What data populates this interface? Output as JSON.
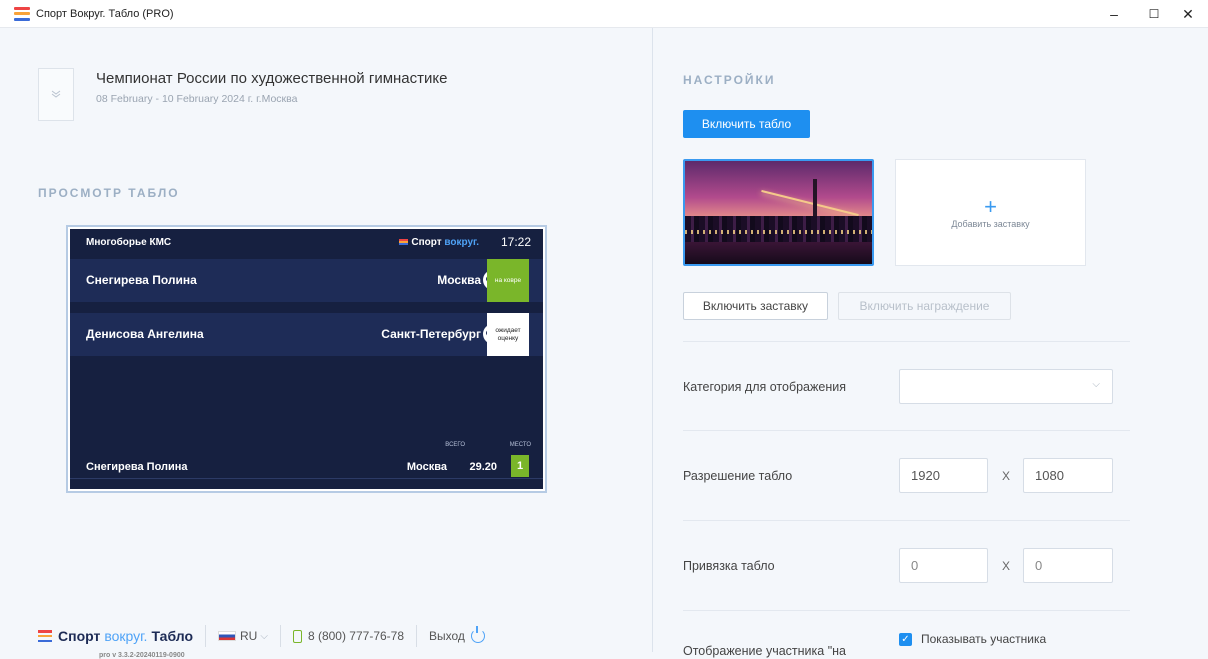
{
  "window": {
    "title": "Спорт Вокруг. Табло (PRO)",
    "minimize": "–",
    "maximize": "☐",
    "close": "✕"
  },
  "event": {
    "title": "Чемпионат России по художественной гимнастике",
    "dates": "08 February - 10 February 2024 г. г.Москва"
  },
  "preview": {
    "section_title": "ПРОСМОТР ТАБЛО",
    "board": {
      "category": "Многоборье КМС",
      "logo_a": "Спорт",
      "logo_b": "вокруг.",
      "time": "17:22",
      "rows": [
        {
          "name": "Снегирева Полина",
          "city": "Москва",
          "status": "на ковре"
        },
        {
          "name": "Денисова Ангелина",
          "city": "Санкт-Петербург",
          "status": "ожидает оценку"
        }
      ],
      "footer": {
        "total_label": "ВСЕГО",
        "place_label": "МЕСТО",
        "name": "Снегирева Полина",
        "city": "Москва",
        "score": "29.20",
        "place": "1"
      }
    }
  },
  "footer": {
    "logo_a": "Спорт",
    "logo_b": "вокруг.",
    "logo_c": "Табло",
    "version": "pro v 3.3.2-20240119-0900",
    "lang": "RU",
    "lang_chevron": "⌵",
    "phone": "8 (800) 777-76-78",
    "logout": "Выход"
  },
  "settings": {
    "title": "НАСТРОЙКИ",
    "enable_board": "Включить табло",
    "add_splash_plus": "+",
    "add_splash": "Добавить заставку",
    "enable_splash": "Включить заставку",
    "enable_award": "Включить награждение",
    "category_label": "Категория для отображения",
    "category_value": "",
    "category_chevron": "⌵",
    "resolution_label": "Разрешение табло",
    "resolution_w": "1920",
    "resolution_h": "1080",
    "x": "X",
    "anchor_label": "Привязка табло",
    "anchor_x": "0",
    "anchor_y": "0",
    "participant_label": "Отображение участника \"на",
    "show_participant": "Показывать участника",
    "check": "✓"
  },
  "colors": {
    "accent": "#1e8ff0",
    "board_bg": "#162040",
    "green": "#7ab62a"
  }
}
